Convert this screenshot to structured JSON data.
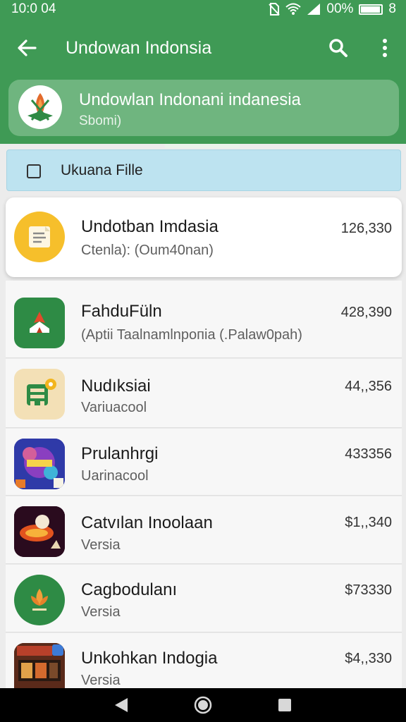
{
  "status_bar": {
    "time": "10:0 04",
    "battery_text": "00%",
    "battery_extra": "8",
    "battery_level": 0.9
  },
  "toolbar": {
    "title": "Undowan Indonsia"
  },
  "app_card": {
    "name": "Undowlan Indonani indanesia",
    "subtitle": "Sbomi)"
  },
  "filter": {
    "label": "Ukuana Fille",
    "checked": false
  },
  "items": [
    {
      "title": "Undotban Imdasia",
      "subtitle": "Ctenla): (Oum40nan)",
      "value": "126,330",
      "icon": "document-icon",
      "selected": true
    },
    {
      "title": "FahduFüln",
      "subtitle": "(Aptii Taalnamlnpoпia (.Palaw0pah)",
      "value": "428,390",
      "icon": "tent-icon",
      "selected": false
    },
    {
      "title": "Nudıksiai",
      "subtitle": "Variuacool",
      "value": "44,,356",
      "icon": "settings-gear-icon",
      "selected": false
    },
    {
      "title": "Prulanhrgi",
      "subtitle": "Uarinacool",
      "value": "433356",
      "icon": "game-thumbnail-icon",
      "selected": false
    },
    {
      "title": "Catvılan Inoolaan",
      "subtitle": "Versia",
      "value": "$1,,340",
      "icon": "racing-icon",
      "selected": false
    },
    {
      "title": "Cagbodulanı",
      "subtitle": "Versia",
      "value": "$73330",
      "icon": "leaf-logo-icon",
      "selected": false
    },
    {
      "title": "Unkohkan Indogia",
      "subtitle": "Versia",
      "value": "$4,,330",
      "icon": "shop-game-icon",
      "selected": false
    }
  ],
  "colors": {
    "header": "#3f9a55",
    "card": "#6fb57f",
    "chip": "#bde3f0"
  }
}
